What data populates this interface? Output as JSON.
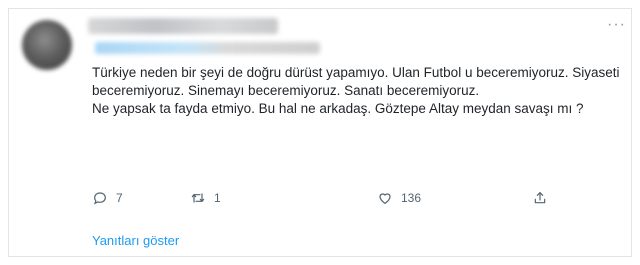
{
  "tweet": {
    "text_lines": [
      "Türkiye neden bir şeyi de doğru dürüst yapamıyo. Ulan Futbol u beceremiyoruz. Siyaseti beceremiyoruz. Sinemayı beceremiyoruz. Sanatı beceremiyoruz.",
      "Ne yapsak ta fayda etmiyo. Bu hal ne arkadaş. Göztepe Altay meydan savaşı mı ?"
    ],
    "more_label": "···",
    "reply_count": "7",
    "retweet_count": "1",
    "like_count": "136"
  },
  "replies": {
    "show_label": "Yanıtları göster"
  },
  "icons": {
    "reply": "reply-icon",
    "retweet": "retweet-icon",
    "like": "heart-icon",
    "share": "share-icon",
    "more": "more-icon"
  },
  "colors": {
    "link": "#1d9bf0",
    "muted": "#536471",
    "border": "#dfe5ea"
  }
}
